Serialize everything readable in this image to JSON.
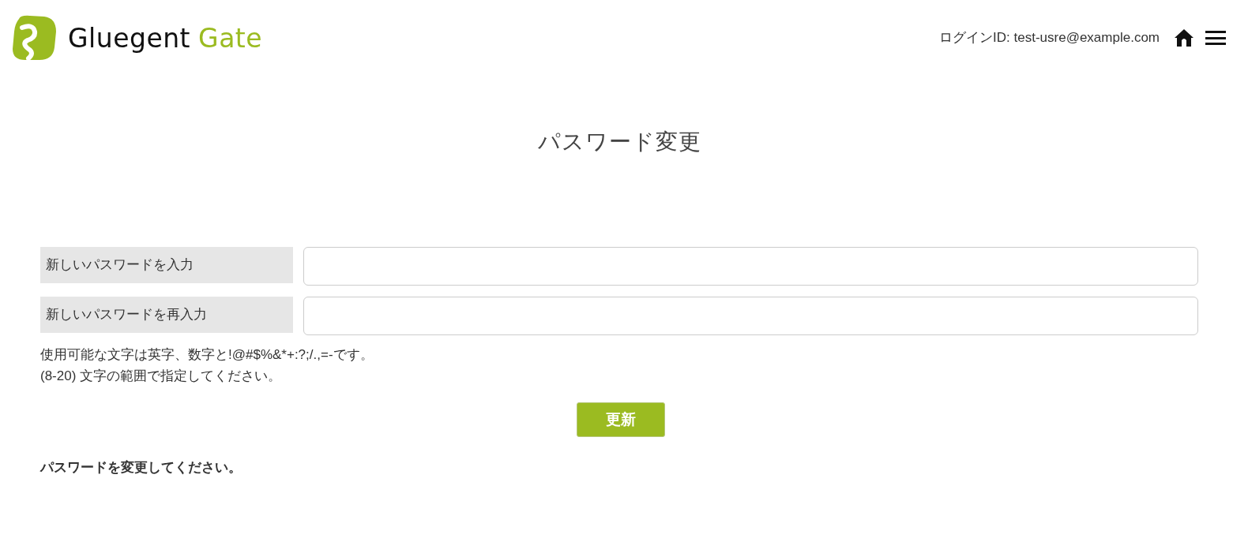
{
  "header": {
    "logo": {
      "primary": "Gluegent",
      "accent": "Gate"
    },
    "login_id": "ログインID: test-usre@example.com"
  },
  "page_title": "パスワード変更",
  "fields": [
    {
      "label": "新しいパスワードを入力"
    },
    {
      "label": "新しいパスワードを再入力"
    }
  ],
  "hint_lines": [
    "使用可能な文字は英字、数字と!@#$%&*+:?;/.,=-です。",
    "(8-20) 文字の範囲で指定してください。"
  ],
  "submit_button": "更新",
  "message": "パスワードを変更してください。"
}
